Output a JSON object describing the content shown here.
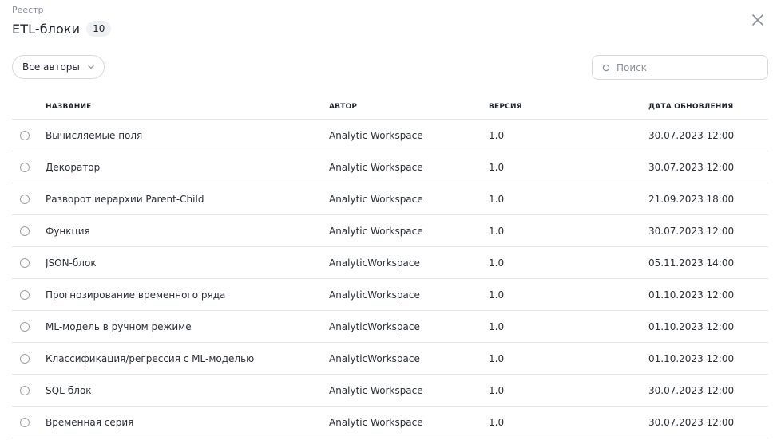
{
  "header": {
    "breadcrumb": "Реестр",
    "title": "ETL-блоки",
    "count": "10"
  },
  "toolbar": {
    "author_filter_label": "Все авторы",
    "search_placeholder": "Поиск"
  },
  "table": {
    "columns": {
      "name": "НАЗВАНИЕ",
      "author": "АВТОР",
      "version": "ВЕРСИЯ",
      "updated": "ДАТА ОБНОВЛЕНИЯ"
    },
    "rows": [
      {
        "name": "Вычисляемые поля",
        "author": "Analytic Workspace",
        "version": "1.0",
        "updated": "30.07.2023 12:00"
      },
      {
        "name": "Декоратор",
        "author": "Analytic Workspace",
        "version": "1.0",
        "updated": "30.07.2023 12:00"
      },
      {
        "name": "Разворот иерархии Parent-Child",
        "author": "Analytic Workspace",
        "version": "1.0",
        "updated": "21.09.2023 18:00"
      },
      {
        "name": "Функция",
        "author": "Analytic Workspace",
        "version": "1.0",
        "updated": "30.07.2023 12:00"
      },
      {
        "name": "JSON-блок",
        "author": "AnalyticWorkspace",
        "version": "1.0",
        "updated": "05.11.2023 14:00"
      },
      {
        "name": "Прогнозирование временного ряда",
        "author": "AnalyticWorkspace",
        "version": "1.0",
        "updated": "01.10.2023 12:00"
      },
      {
        "name": "ML-модель в ручном режиме",
        "author": "AnalyticWorkspace",
        "version": "1.0",
        "updated": "01.10.2023 12:00"
      },
      {
        "name": "Классификация/регрессия с ML-моделью",
        "author": "AnalyticWorkspace",
        "version": "1.0",
        "updated": "01.10.2023 12:00"
      },
      {
        "name": "SQL-блок",
        "author": "Analytic Workspace",
        "version": "1.0",
        "updated": "30.07.2023 12:00"
      },
      {
        "name": "Временная серия",
        "author": "Analytic Workspace",
        "version": "1.0",
        "updated": "30.07.2023 12:00"
      }
    ]
  },
  "icons": {
    "close": "close-icon",
    "chevron": "chevron-down-icon",
    "search": "search-icon",
    "radio": "radio-icon"
  },
  "colors": {
    "text": "#1f2329",
    "muted": "#8a8f98",
    "border": "#d6d9de",
    "divider": "#e2e4e8",
    "badge_bg": "#eef0f3"
  }
}
